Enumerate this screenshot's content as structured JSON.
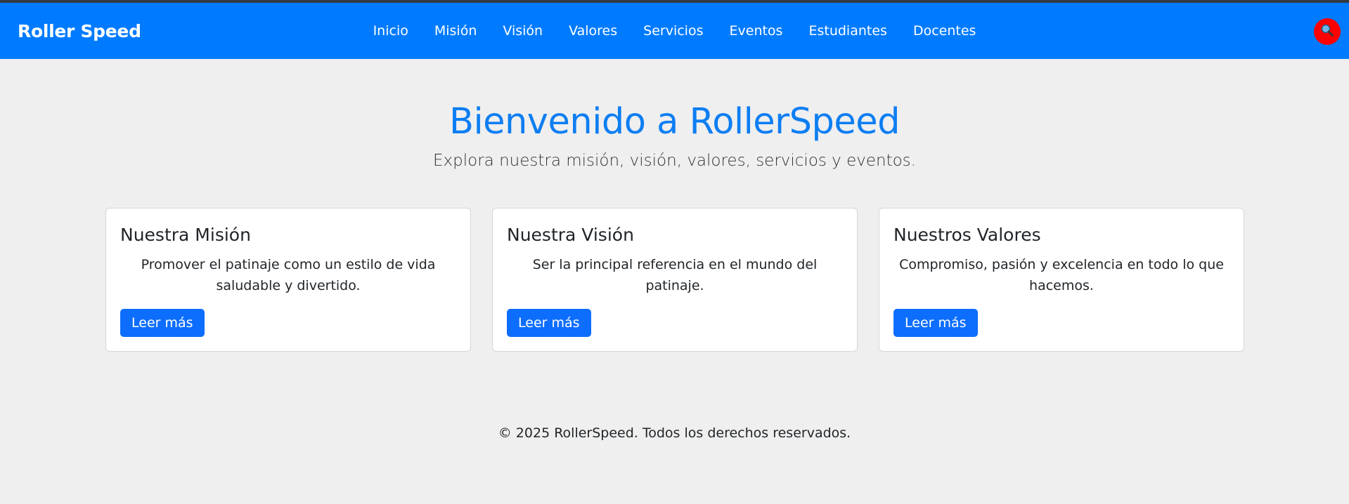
{
  "navbar": {
    "brand": "Roller Speed",
    "links": [
      "Inicio",
      "Misión",
      "Visión",
      "Valores",
      "Servicios",
      "Eventos",
      "Estudiantes",
      "Docentes"
    ],
    "accent_color": "#007bff",
    "search_icon": "search-icon",
    "search_button_color": "#ff0000"
  },
  "hero": {
    "title": "Bienvenido a RollerSpeed",
    "subtitle": "Explora nuestra misión, visión, valores, servicios y eventos."
  },
  "cards": [
    {
      "title": "Nuestra Misión",
      "text": "Promover el patinaje como un estilo de vida saludable y divertido.",
      "button": "Leer más"
    },
    {
      "title": "Nuestra Visión",
      "text": "Ser la principal referencia en el mundo del patinaje.",
      "button": "Leer más"
    },
    {
      "title": "Nuestros Valores",
      "text": "Compromiso, pasión y excelencia en todo lo que hacemos.",
      "button": "Leer más"
    }
  ],
  "footer": {
    "text": "© 2025 RollerSpeed. Todos los derechos reservados."
  }
}
